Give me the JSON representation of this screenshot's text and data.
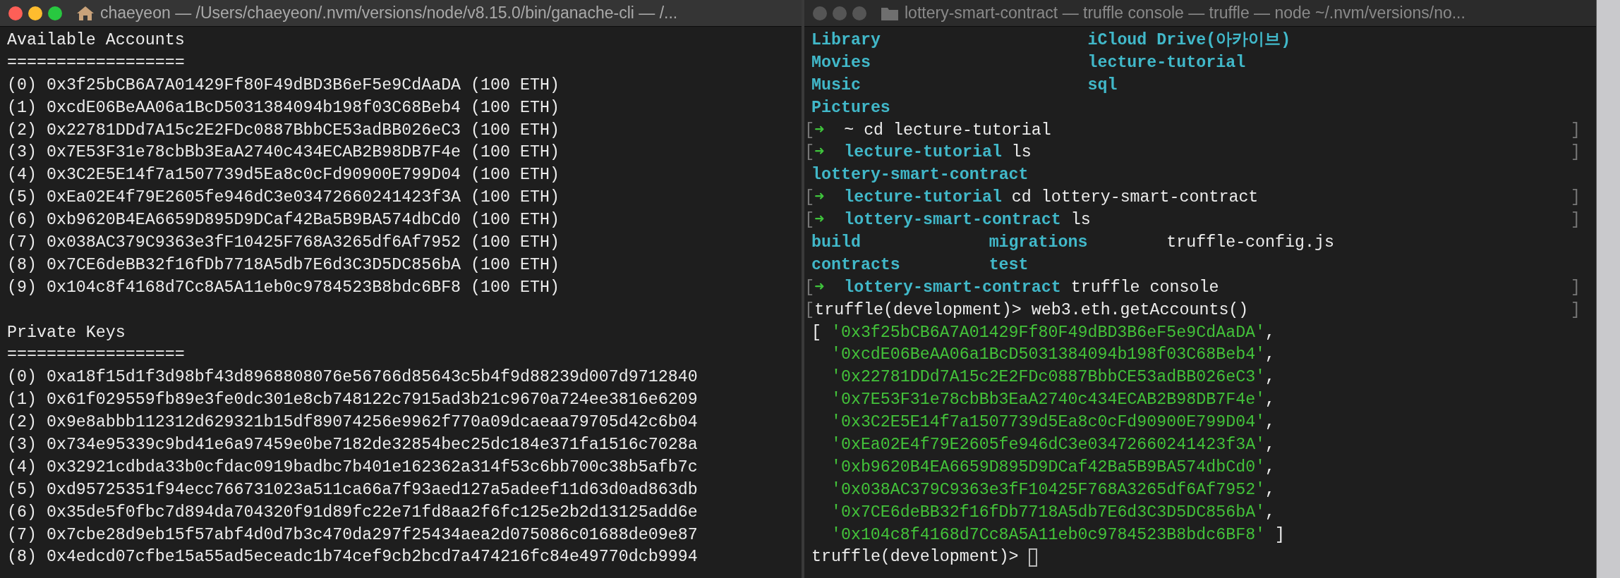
{
  "windows": [
    {
      "title": "chaeyeon — /Users/chaeyeon/.nvm/versions/node/v8.15.0/bin/ganache-cli — /...",
      "active": true,
      "lines": [
        {
          "kind": "line",
          "spans": [
            {
              "text": "Available Accounts",
              "kind": "plain"
            }
          ]
        },
        {
          "kind": "line",
          "spans": [
            {
              "text": "==================",
              "kind": "plain"
            }
          ]
        },
        {
          "kind": "line",
          "spans": [
            {
              "text": "(0) 0x3f25bCB6A7A01429Ff80F49dBD3B6eF5e9CdAaDA (100 ETH)",
              "kind": "plain"
            }
          ]
        },
        {
          "kind": "line",
          "spans": [
            {
              "text": "(1) 0xcdE06BeAA06a1BcD5031384094b198f03C68Beb4 (100 ETH)",
              "kind": "plain"
            }
          ]
        },
        {
          "kind": "line",
          "spans": [
            {
              "text": "(2) 0x22781DDd7A15c2E2FDc0887BbbCE53adBB026eC3 (100 ETH)",
              "kind": "plain"
            }
          ]
        },
        {
          "kind": "line",
          "spans": [
            {
              "text": "(3) 0x7E53F31e78cbBb3EaA2740c434ECAB2B98DB7F4e (100 ETH)",
              "kind": "plain"
            }
          ]
        },
        {
          "kind": "line",
          "spans": [
            {
              "text": "(4) 0x3C2E5E14f7a1507739d5Ea8c0cFd90900E799D04 (100 ETH)",
              "kind": "plain"
            }
          ]
        },
        {
          "kind": "line",
          "spans": [
            {
              "text": "(5) 0xEa02E4f79E2605fe946dC3e03472660241423f3A (100 ETH)",
              "kind": "plain"
            }
          ]
        },
        {
          "kind": "line",
          "spans": [
            {
              "text": "(6) 0xb9620B4EA6659D895D9DCaf42Ba5B9BA574dbCd0 (100 ETH)",
              "kind": "plain"
            }
          ]
        },
        {
          "kind": "line",
          "spans": [
            {
              "text": "(7) 0x038AC379C9363e3fF10425F768A3265df6Af7952 (100 ETH)",
              "kind": "plain"
            }
          ]
        },
        {
          "kind": "line",
          "spans": [
            {
              "text": "(8) 0x7CE6deBB32f16fDb7718A5db7E6d3C3D5DC856bA (100 ETH)",
              "kind": "plain"
            }
          ]
        },
        {
          "kind": "line",
          "spans": [
            {
              "text": "(9) 0x104c8f4168d7Cc8A5A11eb0c9784523B8bdc6BF8 (100 ETH)",
              "kind": "plain"
            }
          ]
        },
        {
          "kind": "blank"
        },
        {
          "kind": "line",
          "spans": [
            {
              "text": "Private Keys",
              "kind": "plain"
            }
          ]
        },
        {
          "kind": "line",
          "spans": [
            {
              "text": "==================",
              "kind": "plain"
            }
          ]
        },
        {
          "kind": "line",
          "spans": [
            {
              "text": "(0) 0xa18f15d1f3d98bf43d8968808076e56766d85643c5b4f9d88239d007d9712840",
              "kind": "plain"
            }
          ]
        },
        {
          "kind": "line",
          "spans": [
            {
              "text": "(1) 0x61f029559fb89e3fe0dc301e8cb748122c7915ad3b21c9670a724ee3816e6209",
              "kind": "plain"
            }
          ]
        },
        {
          "kind": "line",
          "spans": [
            {
              "text": "(2) 0x9e8abbb112312d629321b15df89074256e9962f770a09dcaeaa79705d42c6b04",
              "kind": "plain"
            }
          ]
        },
        {
          "kind": "line",
          "spans": [
            {
              "text": "(3) 0x734e95339c9bd41e6a97459e0be7182de32854bec25dc184e371fa1516c7028a",
              "kind": "plain"
            }
          ]
        },
        {
          "kind": "line",
          "spans": [
            {
              "text": "(4) 0x32921cdbda33b0cfdac0919badbc7b401e162362a314f53c6bb700c38b5afb7c",
              "kind": "plain"
            }
          ]
        },
        {
          "kind": "line",
          "spans": [
            {
              "text": "(5) 0xd95725351f94ecc766731023a511ca66a7f93aed127a5adeef11d63d0ad863db",
              "kind": "plain"
            }
          ]
        },
        {
          "kind": "line",
          "spans": [
            {
              "text": "(6) 0x35de5f0fbc7d894da704320f91d89fc22e71fd8aa2f6fc125e2b2d13125add6e",
              "kind": "plain"
            }
          ]
        },
        {
          "kind": "line",
          "spans": [
            {
              "text": "(7) 0x7cbe28d9eb15f57abf4d0d7b3c470da297f25434aea2d075086c01688de09e87",
              "kind": "plain"
            }
          ]
        },
        {
          "kind": "line",
          "spans": [
            {
              "text": "(8) 0x4edcd07cfbe15a55ad5eceadc1b74cef9cb2bcd7a474216fc84e49770dcb9994",
              "kind": "plain"
            }
          ]
        }
      ]
    },
    {
      "title": "lottery-smart-contract — truffle console — truffle — node ~/.nvm/versions/no...",
      "active": false,
      "lines": [
        {
          "kind": "columns",
          "cells": [
            {
              "text": "Library",
              "kind": "dir"
            },
            {
              "text": "iCloud Drive(아카이브)",
              "kind": "dir"
            }
          ]
        },
        {
          "kind": "columns",
          "cells": [
            {
              "text": "Movies",
              "kind": "dir"
            },
            {
              "text": "lecture-tutorial",
              "kind": "dir"
            }
          ]
        },
        {
          "kind": "columns",
          "cells": [
            {
              "text": "Music",
              "kind": "dir"
            },
            {
              "text": "sql",
              "kind": "dir"
            }
          ]
        },
        {
          "kind": "columns",
          "cells": [
            {
              "text": "Pictures",
              "kind": "dir"
            }
          ]
        },
        {
          "kind": "prompt",
          "open_mark": "[",
          "spans": [
            {
              "text": "➜",
              "kind": "arrow"
            },
            {
              "text": "~",
              "kind": "plain"
            },
            {
              "text": "cd lecture-tutorial",
              "kind": "plain"
            }
          ],
          "close_mark": "]"
        },
        {
          "kind": "prompt",
          "open_mark": "[",
          "spans": [
            {
              "text": "➜",
              "kind": "arrow"
            },
            {
              "text": "lecture-tutorial",
              "kind": "dir"
            },
            {
              "text": "ls",
              "kind": "plain"
            }
          ],
          "close_mark": "]"
        },
        {
          "kind": "line",
          "spans": [
            {
              "text": "lottery-smart-contract",
              "kind": "dir"
            }
          ]
        },
        {
          "kind": "prompt",
          "open_mark": "[",
          "spans": [
            {
              "text": "➜",
              "kind": "arrow"
            },
            {
              "text": "lecture-tutorial",
              "kind": "dir"
            },
            {
              "text": "cd lottery-smart-contract",
              "kind": "plain"
            }
          ],
          "close_mark": "]"
        },
        {
          "kind": "prompt",
          "open_mark": "[",
          "spans": [
            {
              "text": "➜",
              "kind": "arrow"
            },
            {
              "text": "lottery-smart-contract",
              "kind": "dir"
            },
            {
              "text": "ls",
              "kind": "plain"
            }
          ],
          "close_mark": "]"
        },
        {
          "kind": "columns",
          "cells": [
            {
              "text": "build",
              "kind": "dir"
            },
            {
              "text": "migrations",
              "kind": "dir"
            },
            {
              "text": "truffle-config.js",
              "kind": "plain"
            }
          ]
        },
        {
          "kind": "columns",
          "cells": [
            {
              "text": "contracts",
              "kind": "dir"
            },
            {
              "text": "test",
              "kind": "dir"
            }
          ]
        },
        {
          "kind": "prompt",
          "open_mark": "[",
          "spans": [
            {
              "text": "➜",
              "kind": "arrow"
            },
            {
              "text": "lottery-smart-contract",
              "kind": "dir"
            },
            {
              "text": "truffle console",
              "kind": "plain"
            }
          ],
          "close_mark": "]"
        },
        {
          "kind": "prompt",
          "open_mark": "[",
          "spans": [
            {
              "text": "truffle(development)>",
              "kind": "plain"
            },
            {
              "text": "web3.eth.getAccounts()",
              "kind": "plain"
            }
          ],
          "close_mark": "]"
        },
        {
          "kind": "array_item",
          "lead": "[",
          "value": "'0x3f25bCB6A7A01429Ff80F49dBD3B6eF5e9CdAaDA'",
          "separator": ","
        },
        {
          "kind": "array_item",
          "value": "'0xcdE06BeAA06a1BcD5031384094b198f03C68Beb4'",
          "separator": ","
        },
        {
          "kind": "array_item",
          "value": "'0x22781DDd7A15c2E2FDc0887BbbCE53adBB026eC3'",
          "separator": ","
        },
        {
          "kind": "array_item",
          "value": "'0x7E53F31e78cbBb3EaA2740c434ECAB2B98DB7F4e'",
          "separator": ","
        },
        {
          "kind": "array_item",
          "value": "'0x3C2E5E14f7a1507739d5Ea8c0cFd90900E799D04'",
          "separator": ","
        },
        {
          "kind": "array_item",
          "value": "'0xEa02E4f79E2605fe946dC3e03472660241423f3A'",
          "separator": ","
        },
        {
          "kind": "array_item",
          "value": "'0xb9620B4EA6659D895D9DCaf42Ba5B9BA574dbCd0'",
          "separator": ","
        },
        {
          "kind": "array_item",
          "value": "'0x038AC379C9363e3fF10425F768A3265df6Af7952'",
          "separator": ","
        },
        {
          "kind": "array_item",
          "value": "'0x7CE6deBB32f16fDb7718A5db7E6d3C3D5DC856bA'",
          "separator": ","
        },
        {
          "kind": "array_item",
          "value": "'0x104c8f4168d7Cc8A5A11eb0c9784523B8bdc6BF8'",
          "close": "]"
        },
        {
          "kind": "input",
          "prompt": "truffle(development)>"
        }
      ]
    }
  ]
}
